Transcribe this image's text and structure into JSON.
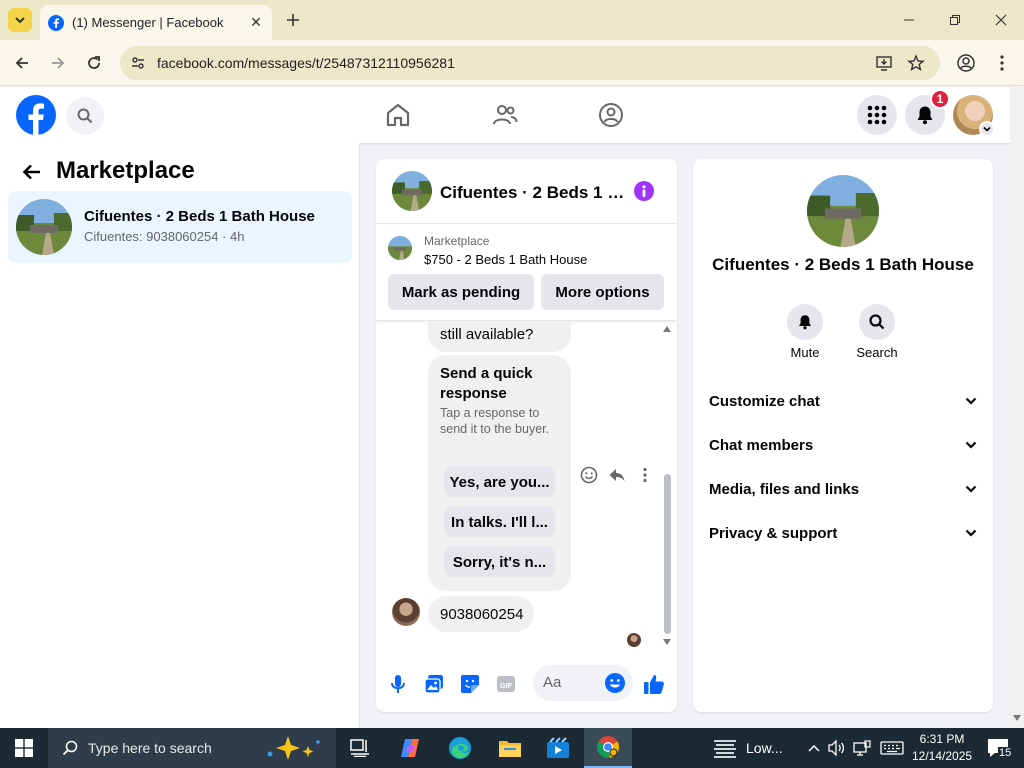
{
  "browser": {
    "tab_title": "(1) Messenger | Facebook",
    "url": "facebook.com/messages/t/25487312110956281"
  },
  "header": {
    "notification_count": "1"
  },
  "sidebar": {
    "title": "Marketplace",
    "conversation": {
      "name": "Cifuentes · 2 Beds 1 Bath House",
      "preview": "Cifuentes: 9038060254 · 4h"
    }
  },
  "chat": {
    "title": "Cifuentes · 2 Beds 1 B...",
    "listing_source": "Marketplace",
    "listing_title": "$750 - 2 Beds 1 Bath House",
    "mark_pending_label": "Mark as pending",
    "more_options_label": "More options",
    "partial_message": "still available?",
    "quick_response": {
      "title": "Send a quick response",
      "subtitle": "Tap a response to send it to the buyer.",
      "options": [
        "Yes, are you...",
        "In talks. I'll l...",
        "Sorry, it's n..."
      ]
    },
    "phone_message": "9038060254",
    "composer_placeholder": "Aa"
  },
  "info_panel": {
    "name": "Cifuentes · 2 Beds 1 Bath House",
    "actions": [
      {
        "label": "Mute",
        "icon": "bell-icon"
      },
      {
        "label": "Search",
        "icon": "search-icon"
      }
    ],
    "sections": [
      "Customize chat",
      "Chat members",
      "Media, files and links",
      "Privacy & support"
    ]
  },
  "taskbar": {
    "search_placeholder": "Type here to search",
    "weather": "Low...",
    "time": "6:31 PM",
    "date": "12/14/2025",
    "notification_count": "15"
  },
  "colors": {
    "facebook_blue": "#0866ff",
    "badge_red": "#e41e3f",
    "info_purple": "#a033ff",
    "selected_bg": "#ebf5ff"
  }
}
